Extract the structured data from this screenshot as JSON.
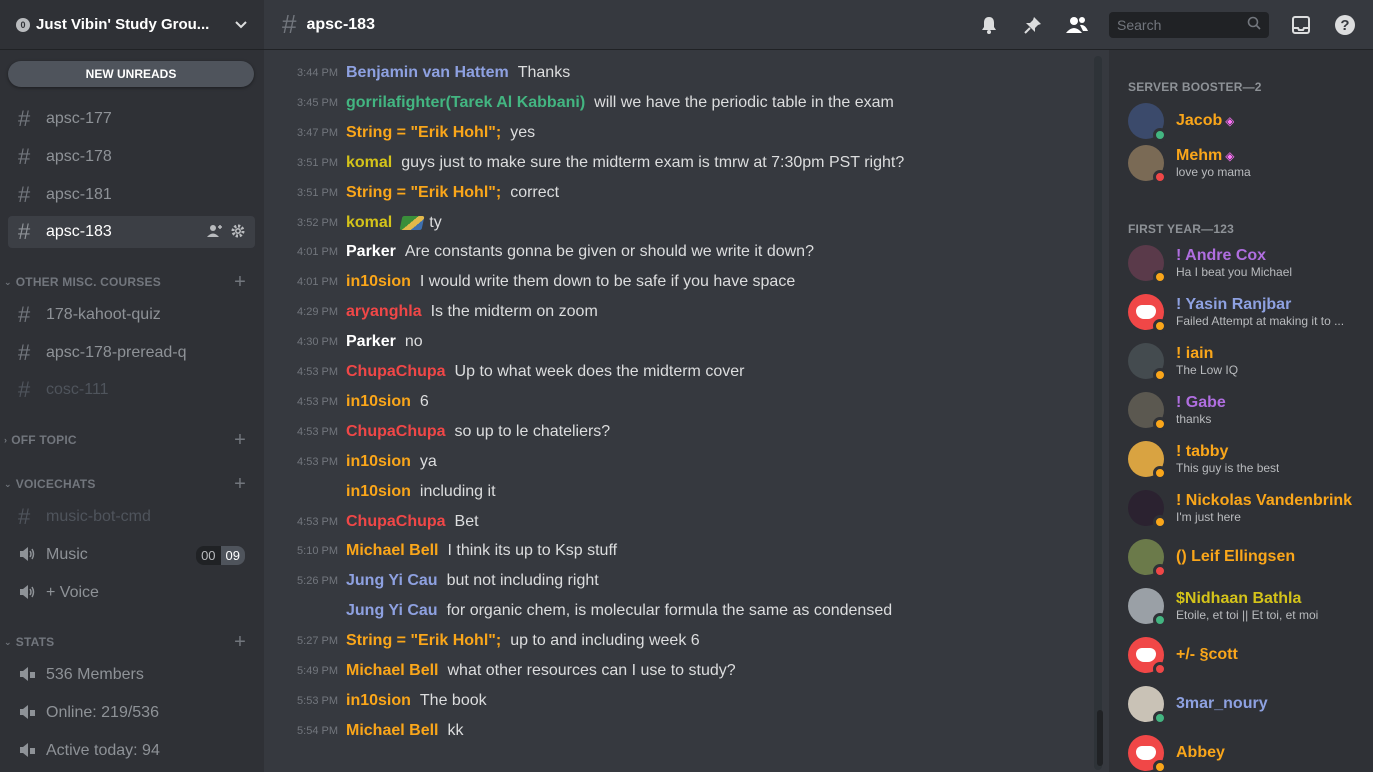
{
  "server": {
    "badge": "0",
    "name": "Just Vibin' Study Grou..."
  },
  "sidebar": {
    "new_unreads": "NEW UNREADS",
    "channels": [
      {
        "label": "apsc-177"
      },
      {
        "label": "apsc-178"
      },
      {
        "label": "apsc-181"
      },
      {
        "label": "apsc-183"
      }
    ],
    "cat_other": "OTHER MISC. COURSES",
    "other_channels": [
      {
        "label": "178-kahoot-quiz"
      },
      {
        "label": "apsc-178-preread-q"
      },
      {
        "label": "cosc-111"
      }
    ],
    "cat_offtopic": "OFF TOPIC",
    "cat_voice": "VOICECHATS",
    "voice": [
      {
        "label": "music-bot-cmd"
      },
      {
        "label": "Music",
        "count_a": "00",
        "count_b": "09"
      },
      {
        "label": "+ Voice"
      }
    ],
    "cat_stats": "STATS",
    "stats": [
      {
        "label": "536 Members"
      },
      {
        "label": "Online: 219/536"
      },
      {
        "label": "Active today: 94"
      }
    ]
  },
  "topbar": {
    "channel": "apsc-183",
    "search_placeholder": "Search"
  },
  "messages": [
    {
      "time": "3:44 PM",
      "author": "Benjamin van Hattem",
      "color": "#8ea1e1",
      "text": "Thanks"
    },
    {
      "time": "3:45 PM",
      "author": "gorrilafighter(Tarek Al Kabbani)",
      "color": "#43b581",
      "text": "will we have the periodic table in the exam"
    },
    {
      "time": "3:47 PM",
      "author": "String = \"Erik Hohl\";",
      "color": "#faa61a",
      "text": "yes"
    },
    {
      "time": "3:51 PM",
      "author": "komal",
      "color": "#d4c31a",
      "text": "guys just to make sure the midterm exam is tmrw at 7:30pm PST right?"
    },
    {
      "time": "3:51 PM",
      "author": "String = \"Erik Hohl\";",
      "color": "#faa61a",
      "text": "correct"
    },
    {
      "time": "3:52 PM",
      "author": "komal",
      "color": "#d4c31a",
      "text": "ty"
    },
    {
      "time": "4:01 PM",
      "author": "Parker",
      "color": "#ffffff",
      "text": "Are constants gonna be given or should we write it down?"
    },
    {
      "time": "4:01 PM",
      "author": "in10sion",
      "color": "#faa61a",
      "text": "I would write them down to be safe if you have space"
    },
    {
      "time": "4:29 PM",
      "author": "aryanghla",
      "color": "#f04747",
      "text": "Is the midterm on zoom"
    },
    {
      "time": "4:30 PM",
      "author": "Parker",
      "color": "#ffffff",
      "text": "no"
    },
    {
      "time": "4:53 PM",
      "author": "ChupaChupa",
      "color": "#f04747",
      "text": "Up to what week does the midterm cover"
    },
    {
      "time": "4:53 PM",
      "author": "in10sion",
      "color": "#faa61a",
      "text": "6"
    },
    {
      "time": "4:53 PM",
      "author": "ChupaChupa",
      "color": "#f04747",
      "text": "so up to le chateliers?"
    },
    {
      "time": "4:53 PM",
      "author": "in10sion",
      "color": "#faa61a",
      "text": "ya"
    },
    {
      "time": "",
      "author": "in10sion",
      "color": "#faa61a",
      "text": "including it"
    },
    {
      "time": "4:53 PM",
      "author": "ChupaChupa",
      "color": "#f04747",
      "text": "Bet"
    },
    {
      "time": "5:10 PM",
      "author": "Michael Bell",
      "color": "#faa61a",
      "text": "I think its up to Ksp stuff"
    },
    {
      "time": "5:26 PM",
      "author": "Jung Yi Cau",
      "color": "#8ea1e1",
      "text": "but not including right"
    },
    {
      "time": "",
      "author": "Jung Yi Cau",
      "color": "#8ea1e1",
      "text": "for organic chem, is molecular formula the same as condensed"
    },
    {
      "time": "5:27 PM",
      "author": "String = \"Erik Hohl\";",
      "color": "#faa61a",
      "text": "up to and including week 6"
    },
    {
      "time": "5:49 PM",
      "author": "Michael Bell",
      "color": "#faa61a",
      "text": "what other resources can I use to study?"
    },
    {
      "time": "5:53 PM",
      "author": "in10sion",
      "color": "#faa61a",
      "text": "The book"
    },
    {
      "time": "5:54 PM",
      "author": "Michael Bell",
      "color": "#faa61a",
      "text": "kk"
    }
  ],
  "members": {
    "cat_booster": "SERVER BOOSTER—2",
    "cat_first": "FIRST YEAR—123",
    "list": [
      {
        "name": "Jacob",
        "sub": "",
        "color": "#faa61a",
        "status": "online",
        "avatar": "#3b4a6b"
      },
      {
        "name": "Mehm",
        "sub": "love yo mama",
        "color": "#faa61a",
        "status": "dnd",
        "avatar": "#7a6a55"
      },
      {
        "name": "! Andre Cox",
        "sub": "Ha I beat you Michael",
        "color": "#b06ee0",
        "status": "idle",
        "avatar": "#5a3a4a"
      },
      {
        "name": "! Yasin Ranjbar",
        "sub": "Failed Attempt at making it to ...",
        "color": "#8ea1e1",
        "status": "idle",
        "avatar": "#f04747"
      },
      {
        "name": "! iain",
        "sub": "The Low IQ",
        "color": "#faa61a",
        "status": "idle",
        "avatar": "#444b4f"
      },
      {
        "name": "! Gabe",
        "sub": "thanks",
        "color": "#b06ee0",
        "status": "idle",
        "avatar": "#5b5850"
      },
      {
        "name": "! tabby",
        "sub": "This guy is the best",
        "color": "#faa61a",
        "status": "idle",
        "avatar": "#d9a341"
      },
      {
        "name": "! Nickolas Vandenbrink",
        "sub": "I'm just here",
        "color": "#faa61a",
        "status": "idle",
        "avatar": "#2b2230"
      },
      {
        "name": "() Leif Ellingsen",
        "sub": "",
        "color": "#faa61a",
        "status": "dnd",
        "avatar": "#6b7a4a"
      },
      {
        "name": "$Nidhaan Bathla",
        "sub": "Etoile, et toi || Et toi, et moi",
        "color": "#d4c31a",
        "status": "online",
        "avatar": "#9aa0a6"
      },
      {
        "name": "+/- §cott",
        "sub": "",
        "color": "#faa61a",
        "status": "dnd",
        "avatar": "#f04747"
      },
      {
        "name": "3mar_noury",
        "sub": "",
        "color": "#8ea1e1",
        "status": "online",
        "avatar": "#c9c2b6"
      },
      {
        "name": "Abbey",
        "sub": "",
        "color": "#faa61a",
        "status": "idle",
        "avatar": "#f04747"
      }
    ]
  }
}
